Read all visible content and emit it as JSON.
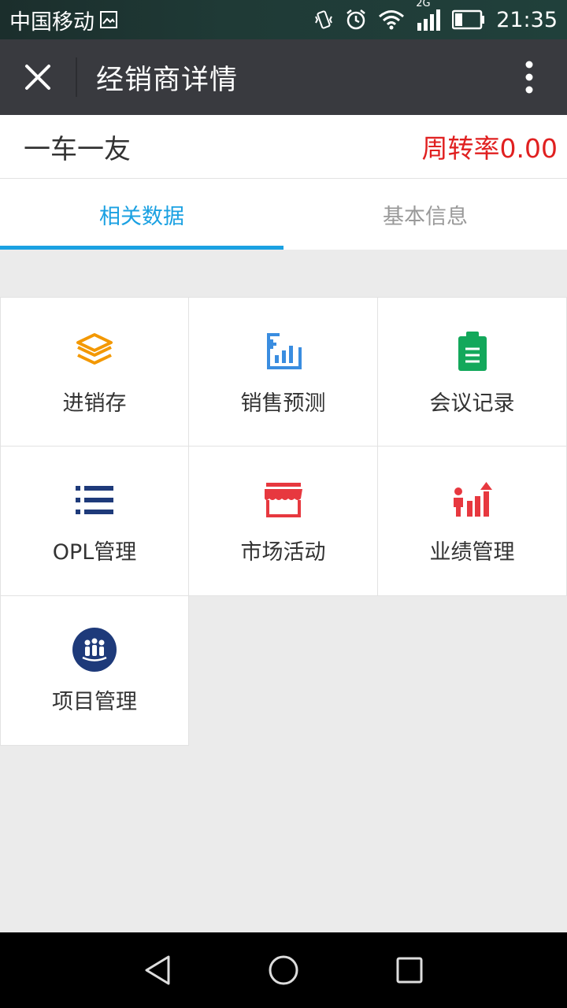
{
  "status_bar": {
    "carrier": "中国移动",
    "network": "2G",
    "time": "21:35"
  },
  "title_bar": {
    "title": "经销商详情"
  },
  "header": {
    "dealer_name": "一车一友",
    "turnover": "周转率0.00"
  },
  "tabs": [
    {
      "label": "相关数据",
      "active": true
    },
    {
      "label": "基本信息",
      "active": false
    }
  ],
  "grid": [
    {
      "label": "进销存",
      "icon": "layers-icon",
      "color": "#f39800"
    },
    {
      "label": "销售预测",
      "icon": "chart-plus-icon",
      "color": "#3a8de0"
    },
    {
      "label": "会议记录",
      "icon": "clipboard-icon",
      "color": "#13a85b"
    },
    {
      "label": "OPL管理",
      "icon": "list-icon",
      "color": "#1e3a7a"
    },
    {
      "label": "市场活动",
      "icon": "store-icon",
      "color": "#e7383f"
    },
    {
      "label": "业绩管理",
      "icon": "performance-icon",
      "color": "#e7383f"
    },
    {
      "label": "项目管理",
      "icon": "team-icon",
      "color": "#1e3a7a"
    }
  ],
  "colors": {
    "accent": "#1ba1e2",
    "turnover": "#e02020",
    "title_bar_bg": "#393a3f"
  }
}
